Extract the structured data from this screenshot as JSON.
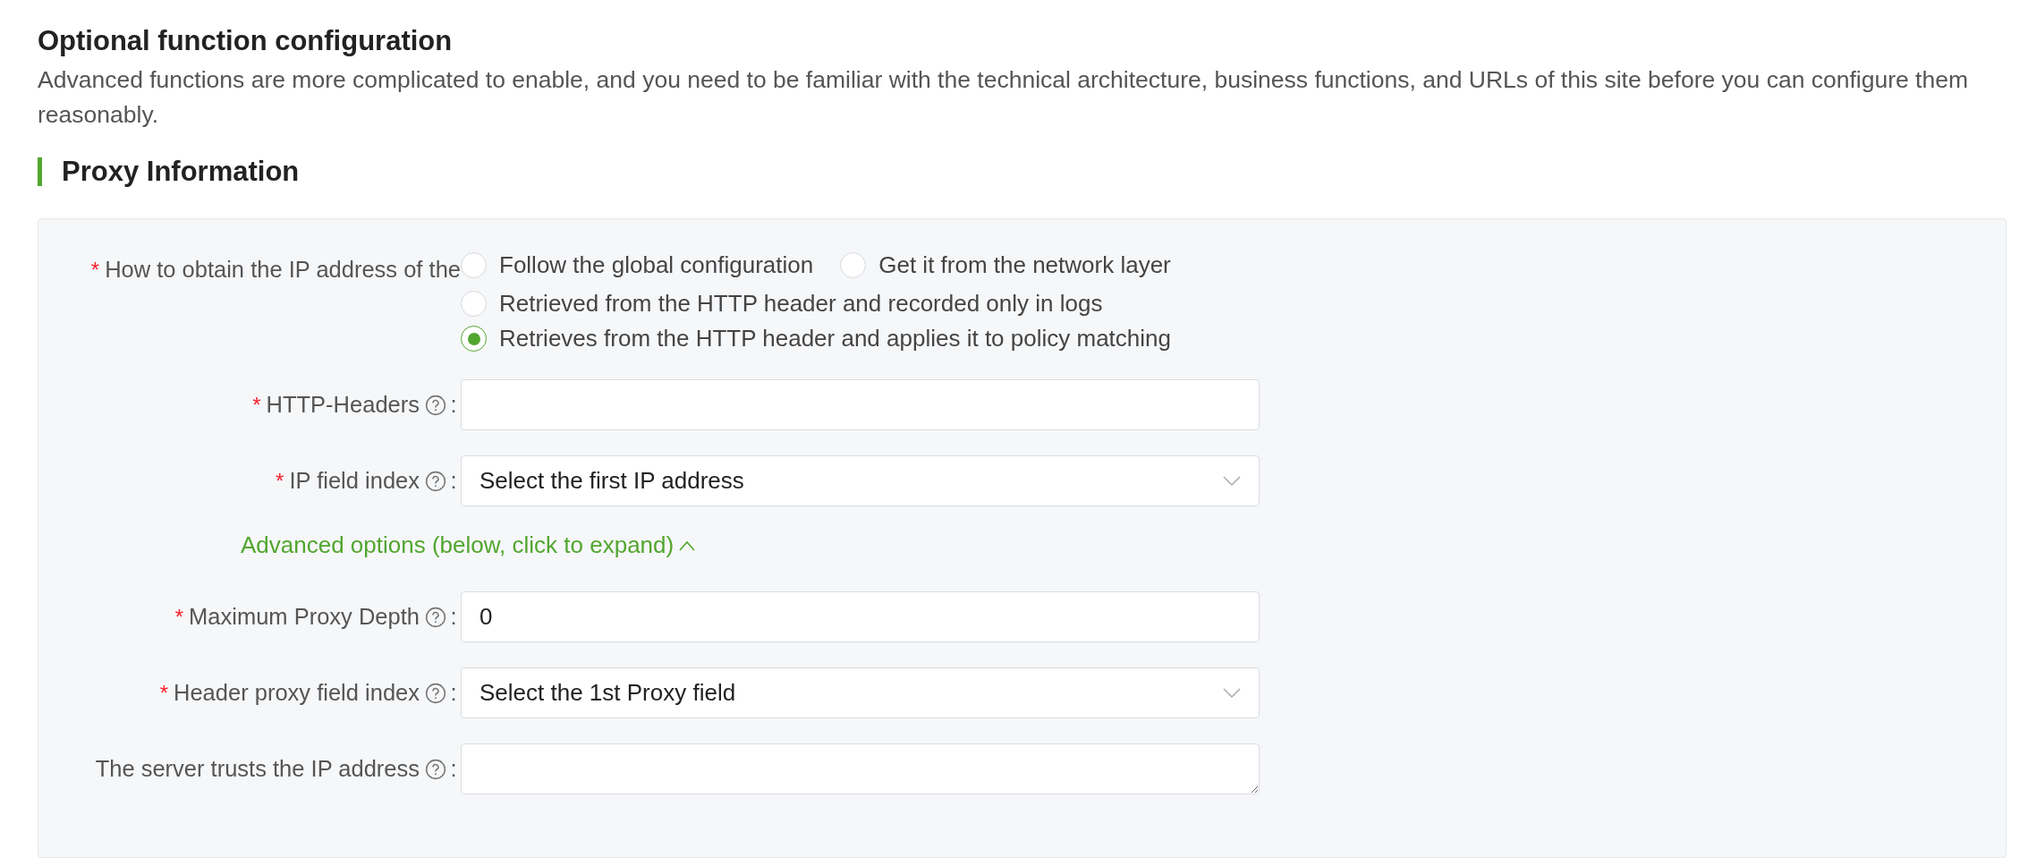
{
  "title": "Optional function configuration",
  "description": "Advanced functions are more complicated to enable, and you need to be familiar with the technical architecture, business functions, and URLs of this site before you can configure them reasonably.",
  "section": {
    "title": "Proxy Information"
  },
  "ip_source": {
    "label": "How to obtain the IP address of the",
    "required_mark": "*",
    "options": [
      {
        "label": "Follow the global configuration",
        "selected": false
      },
      {
        "label": "Get it from the network layer",
        "selected": false
      },
      {
        "label": "Retrieved from the HTTP header and recorded only in logs",
        "selected": false
      },
      {
        "label": "Retrieves from the HTTP header and applies it to policy matching",
        "selected": true
      }
    ]
  },
  "fields_top": [
    {
      "kind": "input",
      "required_mark": "*",
      "label": "HTTP-Headers",
      "colon": ":"
    },
    {
      "kind": "select",
      "required_mark": "*",
      "label": "IP field index",
      "colon": ":",
      "value": "Select the first IP address"
    }
  ],
  "advanced_toggle": {
    "label": "Advanced options (below, click to expand)"
  },
  "fields_advanced": [
    {
      "kind": "input",
      "required_mark": "*",
      "label": "Maximum Proxy Depth",
      "colon": ":",
      "value": "0"
    },
    {
      "kind": "select",
      "required_mark": "*",
      "label": "Header proxy field index",
      "colon": ":",
      "value": "Select the 1st Proxy field"
    },
    {
      "kind": "textarea",
      "label": "The server trusts the IP address",
      "colon": ":"
    }
  ]
}
